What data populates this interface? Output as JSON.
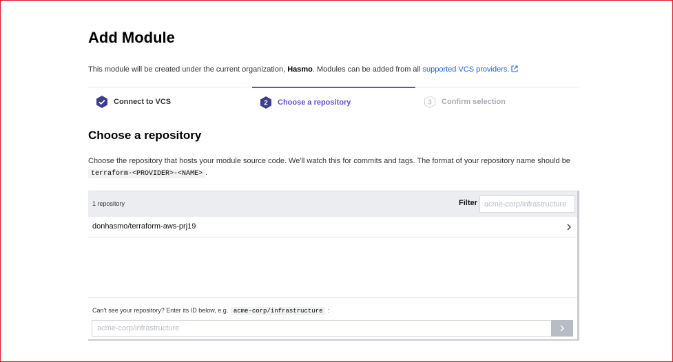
{
  "header": {
    "title": "Add Module"
  },
  "intro": {
    "prefix": "This module will be created under the current organization, ",
    "org": "Hasmo",
    "middle": ". Modules can be added from all ",
    "link": "supported VCS providers."
  },
  "steps": [
    {
      "number": "1",
      "label": "Connect to VCS",
      "state": "complete"
    },
    {
      "number": "2",
      "label": "Choose a repository",
      "state": "active"
    },
    {
      "number": "3",
      "label": "Confirm selection",
      "state": "pending"
    }
  ],
  "section": {
    "title": "Choose a repository",
    "desc_prefix": "Choose the repository that hosts your module source code. We'll watch this for commits and tags. The format of your repository name should be ",
    "desc_code": "terraform-<PROVIDER>-<NAME>",
    "desc_suffix": "."
  },
  "repos": {
    "count_label": "1 repository",
    "filter_label": "Filter",
    "filter_placeholder": "acme-corp/infrastructure",
    "items": [
      {
        "name": "donhasmo/terraform-aws-prj19"
      }
    ]
  },
  "manual": {
    "label_prefix": "Can't see your repository? Enter its ID below, e.g.",
    "label_code": "acme-corp/infrastructure",
    "label_suffix": ":",
    "placeholder": "acme-corp/infrastructure"
  },
  "colors": {
    "accent": "#5c4ee5",
    "link": "#1563ff",
    "step_complete": "#3b3d8f",
    "frame_border": "#d9141e"
  },
  "icons": {
    "step_complete": "check-icon",
    "external_link": "external-link-icon",
    "repo_row": "chevron-right-icon",
    "submit": "chevron-right-icon"
  }
}
